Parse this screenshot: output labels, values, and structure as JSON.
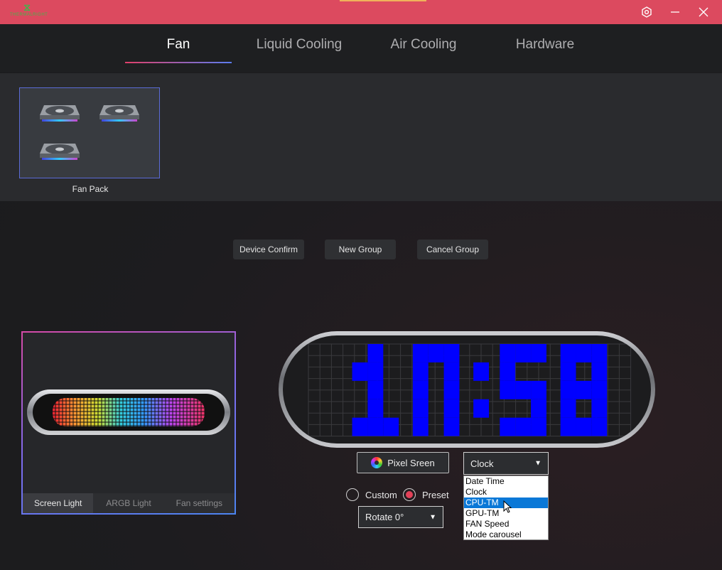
{
  "app": {
    "logo_text": "THERMALRIGHT"
  },
  "window": {
    "settings_icon": "gear-icon",
    "minimize_icon": "minimize-icon",
    "close_icon": "close-icon"
  },
  "nav": {
    "tabs": [
      {
        "label": "Fan"
      },
      {
        "label": "Liquid Cooling"
      },
      {
        "label": "Air Cooling"
      },
      {
        "label": "Hardware"
      }
    ],
    "active": "Fan"
  },
  "devices": [
    {
      "label": "Fan Pack",
      "fan_count": 3,
      "selected": true
    }
  ],
  "group_buttons": {
    "confirm": "Device Confirm",
    "new": "New Group",
    "cancel": "Cancel Group"
  },
  "preview": {
    "tabs": [
      {
        "label": "Screen Light"
      },
      {
        "label": "ARGB Light"
      },
      {
        "label": "Fan settings"
      }
    ],
    "active": "Screen Light"
  },
  "lcd": {
    "display_text": "10:58",
    "pixel_color": "#0000ff"
  },
  "pixel_screen": {
    "label": "Pixel Sreen",
    "icon": "color-wheel-icon"
  },
  "mode_select": {
    "value": "Clock",
    "options": [
      "Date Time",
      "Clock",
      "CPU-TM",
      "GPU-TM",
      "FAN Speed",
      "Mode carousel"
    ],
    "highlighted": "CPU-TM"
  },
  "source": {
    "custom_label": "Custom",
    "preset_label": "Preset",
    "selected": "Preset"
  },
  "rotate_select": {
    "value": "Rotate 0°"
  },
  "colors": {
    "accent": "#dc4a5f",
    "selection_blue": "#0a78d7",
    "radio_checked": "#e24158"
  }
}
